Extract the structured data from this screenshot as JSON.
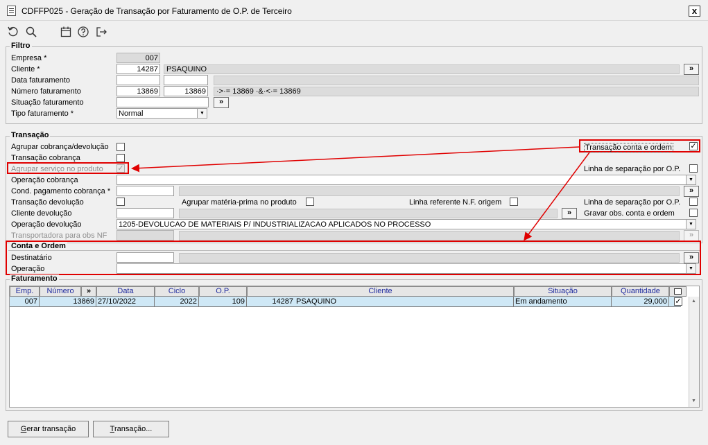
{
  "window": {
    "title": "CDFFP025 - Geração de Transação por Faturamento de O.P. de Terceiro",
    "close_label": "x"
  },
  "toolbar": {
    "icons": [
      "refresh-icon",
      "search-icon",
      "calendar-icon",
      "help-icon",
      "exit-icon"
    ]
  },
  "filtro": {
    "legend": "Filtro",
    "empresa": {
      "label": "Empresa *",
      "value": "007"
    },
    "cliente": {
      "label": "Cliente *",
      "code": "14287",
      "name": "PSAQUINO",
      "btn": "»"
    },
    "data_faturamento": {
      "label": "Data faturamento",
      "from": "",
      "to": ""
    },
    "numero_faturamento": {
      "label": "Número faturamento",
      "from": "13869",
      "to": "13869",
      "expr": "·>·= 13869 ·&·<·= 13869"
    },
    "situacao_faturamento": {
      "label": "Situação faturamento",
      "value": "",
      "btn": "»"
    },
    "tipo_faturamento": {
      "label": "Tipo faturamento *",
      "value": "Normal"
    }
  },
  "transacao": {
    "legend": "Transação",
    "agrupar_cobranca": {
      "label": "Agrupar cobrança/devolução",
      "checked": false
    },
    "transacao_cobranca": {
      "label": "Transação cobrança",
      "checked": false
    },
    "agrupar_servico": {
      "label": "Agrupar serviço no produto",
      "checked": true,
      "mark": "✓"
    },
    "transacao_conta_ordem": {
      "label": "Transação conta e ordem",
      "checked": true,
      "mark": "✓"
    },
    "linha_separacao_1": {
      "label": "Linha de separação por O.P.",
      "checked": false
    },
    "operacao_cobranca": {
      "label": "Operação cobrança",
      "value": ""
    },
    "cond_pagamento": {
      "label": "Cond. pagamento cobrança *",
      "value": "",
      "btn": "»"
    },
    "transacao_devolucao": {
      "label": "Transação devolução",
      "checked": false
    },
    "agrupar_materia_prima": {
      "label": "Agrupar matéria-prima no produto",
      "checked": false
    },
    "linha_referente_nf": {
      "label": "Linha referente N.F. origem",
      "checked": false
    },
    "linha_separacao_2": {
      "label": "Linha de separação por O.P.",
      "checked": false
    },
    "cliente_devolucao": {
      "label": "Cliente devolução",
      "value": "",
      "btn": "»"
    },
    "gravar_obs": {
      "label": "Gravar obs. conta e ordem",
      "checked": false
    },
    "operacao_devolucao": {
      "label": "Operação devolução",
      "value": "1205-DEVOLUCAO DE MATERIAIS P/ INDUSTRIALIZACAO APLICADOS NO PROCESSO"
    },
    "transportadora": {
      "label": "Transportadora para obs NF",
      "value": "",
      "btn": "»"
    }
  },
  "conta_ordem": {
    "legend": "Conta e Ordem",
    "destinatario": {
      "label": "Destinatário",
      "value": "",
      "btn": "»"
    },
    "operacao": {
      "label": "Operação",
      "value": ""
    }
  },
  "faturamento": {
    "legend": "Faturamento",
    "columns": {
      "emp": "Emp.",
      "numero": "Número",
      "nav": "»",
      "data": "Data",
      "ciclo": "Ciclo",
      "op": "O.P.",
      "cliente": "Cliente",
      "situacao": "Situação",
      "quantidade": "Quantidade"
    },
    "rows": [
      {
        "emp": "007",
        "numero": "13869",
        "data": "27/10/2022",
        "ciclo": "2022",
        "op": "109",
        "cliente_code": "14287",
        "cliente_name": "PSAQUINO",
        "situacao": "Em andamento",
        "quantidade": "29,000",
        "selected": true,
        "mark": "✓"
      }
    ]
  },
  "buttons": {
    "gerar_transacao": {
      "underline": "G",
      "rest": "erar transação"
    },
    "transacao": {
      "underline": "T",
      "rest": "ransação..."
    }
  },
  "colors": {
    "annotation": "#e00000",
    "row_highlight": "#cfe8f6",
    "header_text": "#1e2a9e"
  }
}
